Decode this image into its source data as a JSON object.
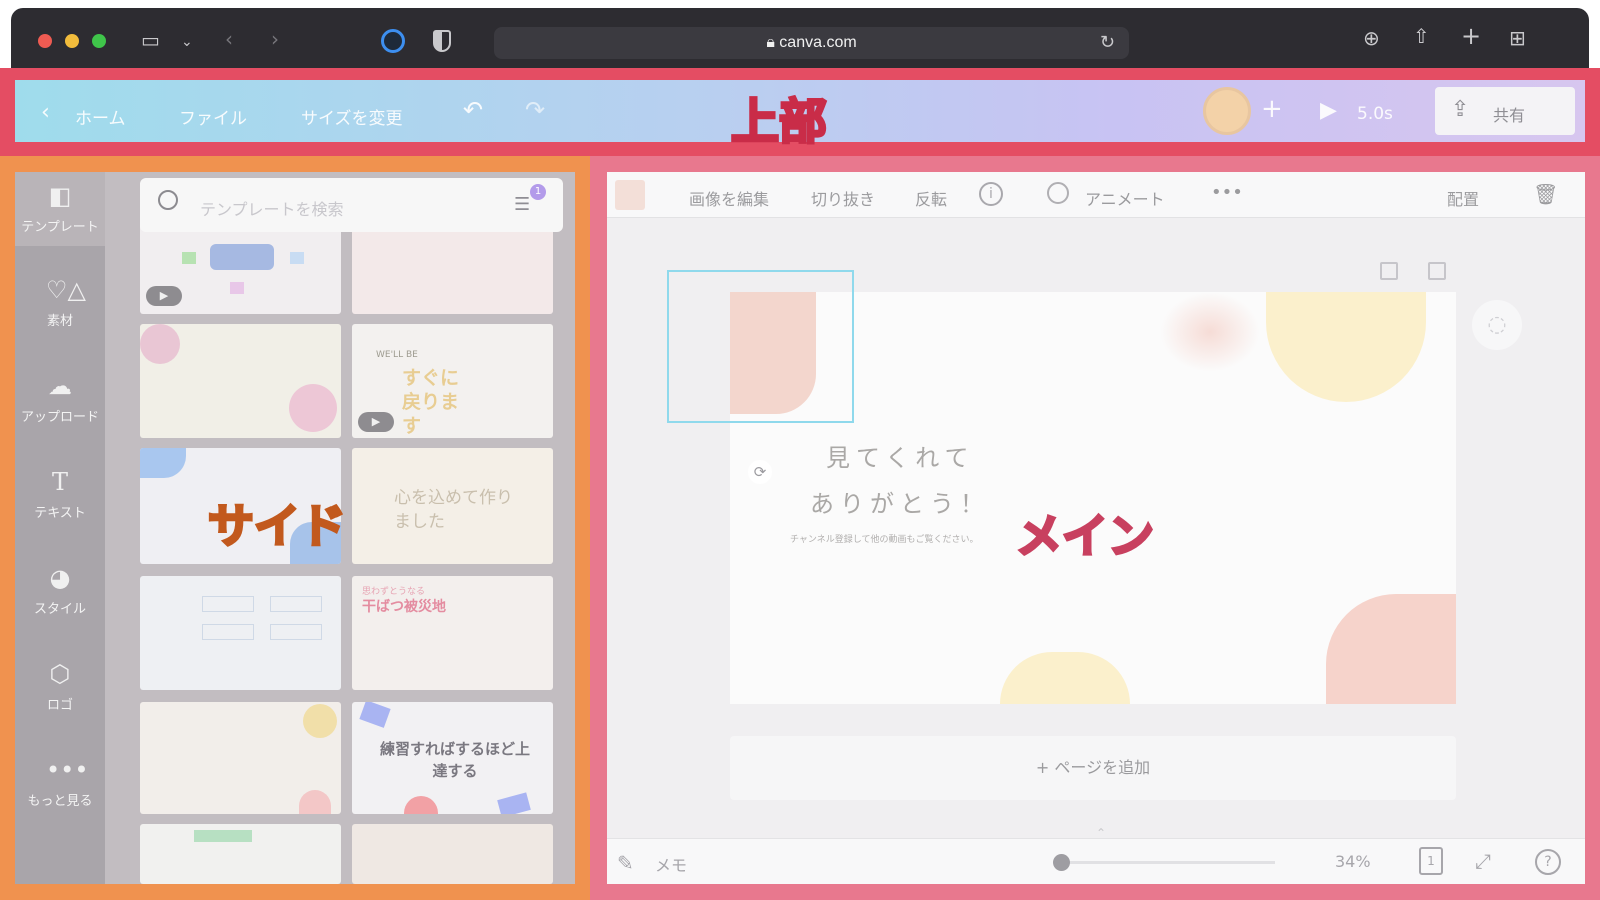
{
  "browser": {
    "url": "canva.com",
    "colors": {
      "close": "#ee5b52",
      "minimize": "#f2bc3c",
      "maximize": "#3fc54a"
    }
  },
  "topbar": {
    "home_label": "ホーム",
    "file_label": "ファイル",
    "resize_label": "サイズを変更",
    "play_duration": "5.0s",
    "share_label": "共有",
    "region_label": "上部"
  },
  "sidebar": {
    "region_label": "サイド",
    "rail_items": [
      {
        "label": "テンプレート",
        "icon": "template-icon"
      },
      {
        "label": "素材",
        "icon": "elements-icon"
      },
      {
        "label": "アップロード",
        "icon": "upload-icon"
      },
      {
        "label": "テキスト",
        "icon": "text-icon"
      },
      {
        "label": "スタイル",
        "icon": "palette-icon"
      },
      {
        "label": "ロゴ",
        "icon": "logo-icon"
      },
      {
        "label": "もっと見る",
        "icon": "more-icon"
      }
    ],
    "search_placeholder": "テンプレートを検索",
    "filter_badge": "1",
    "thumbs": {
      "t4_line1": "WE'LL BE",
      "t4_text": "すぐに戻ります",
      "t6_text": "心を込めて作りました",
      "t8_small": "思わずとうなる",
      "t8_title": "干ばつ被災地",
      "t10_text": "練習すればするほど上達する"
    }
  },
  "main": {
    "region_label": "メイン",
    "toolbar": {
      "edit_image": "画像を編集",
      "crop": "切り抜き",
      "flip": "反転",
      "animate": "アニメート",
      "position": "配置"
    },
    "canvas": {
      "title_line1": "見てくれて",
      "title_line2": "ありがとう！",
      "subtitle": "チャンネル登録して他の動画もご覧ください。"
    },
    "add_page": "+ ページを追加",
    "bottom": {
      "notes": "メモ",
      "zoom": "34%",
      "page_count": "1"
    }
  }
}
